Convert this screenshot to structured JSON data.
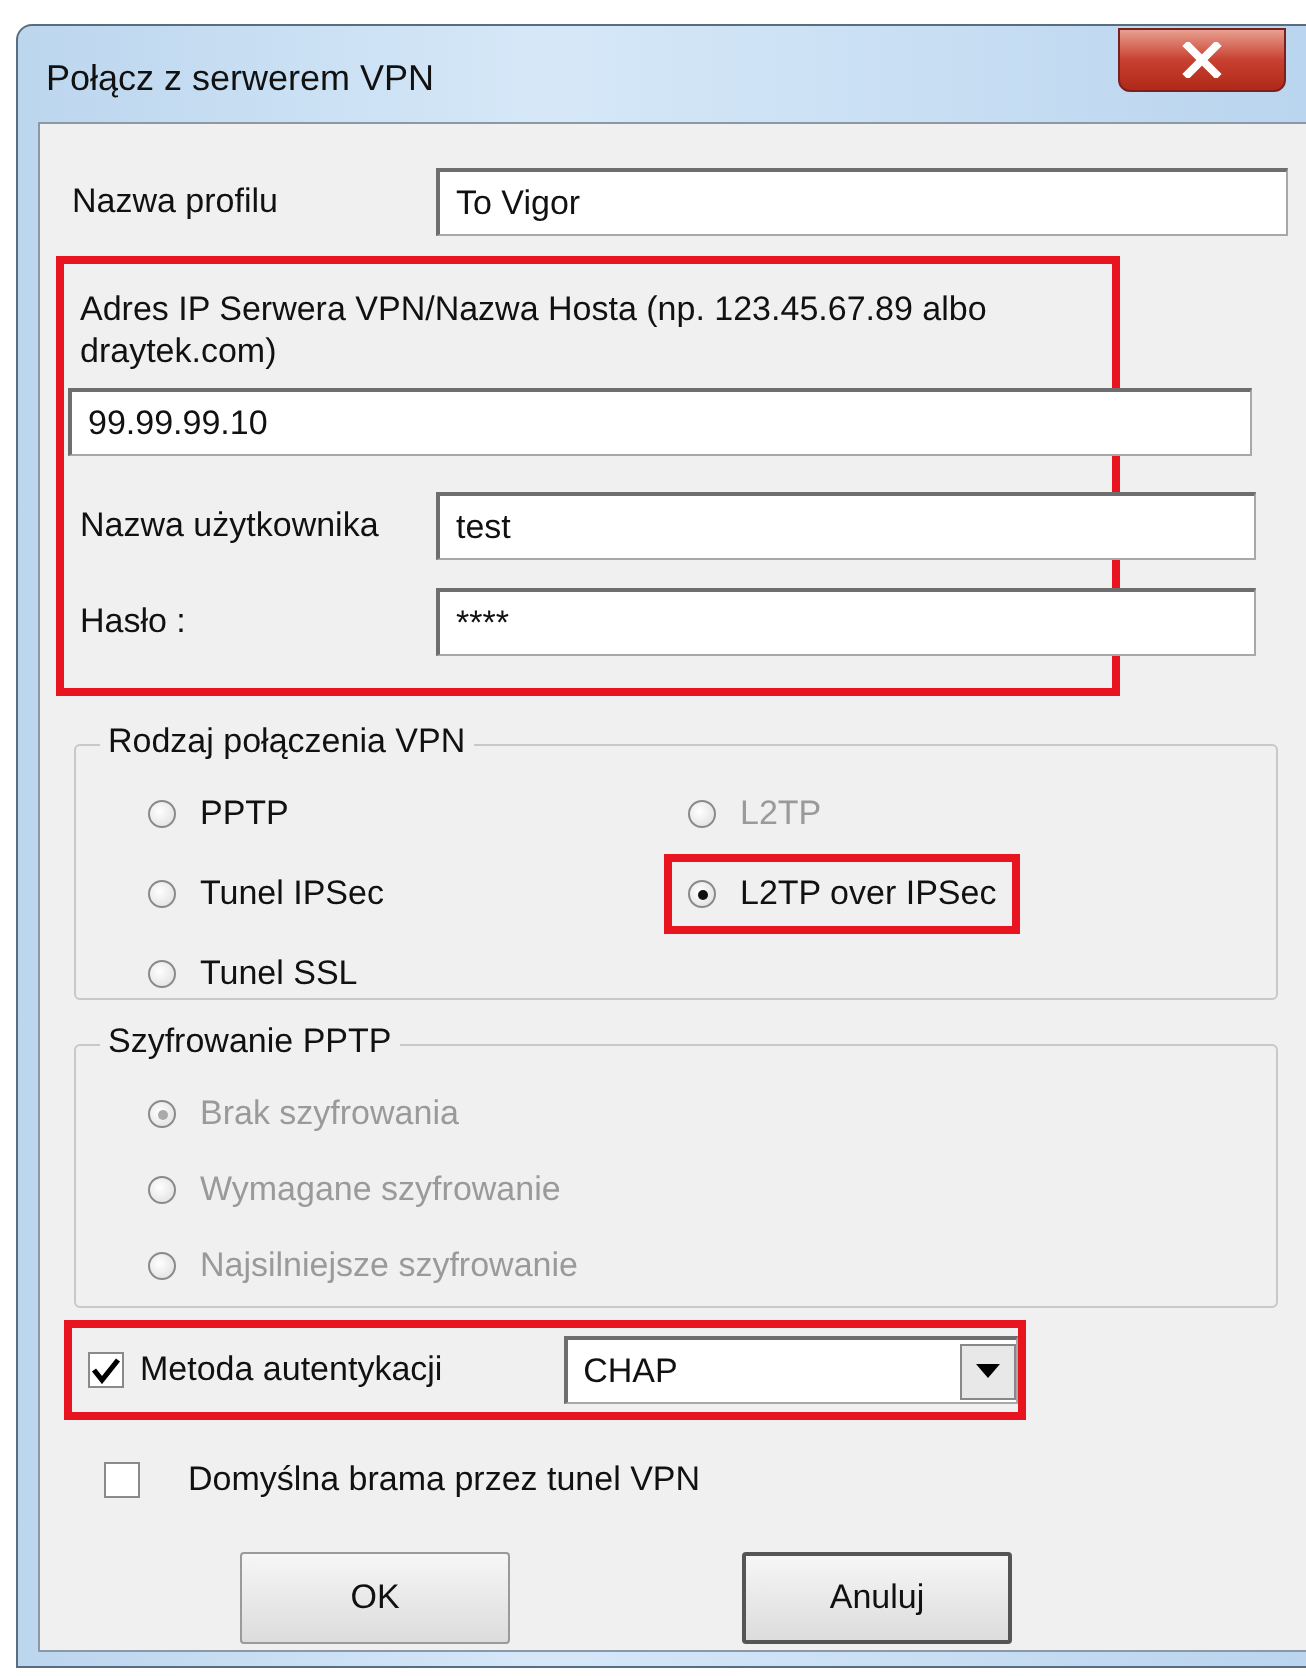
{
  "window": {
    "title": "Połącz z serwerem VPN"
  },
  "profile": {
    "label": "Nazwa profilu",
    "value": "To Vigor"
  },
  "login": {
    "highlighted": true,
    "fields": [
      {
        "kind": "stacked",
        "label": "Adres IP Serwera VPN/Nazwa Hosta (np. 123.45.67.89 albo draytek.com)",
        "value": "99.99.99.10"
      },
      {
        "kind": "inline",
        "label": "Nazwa użytkownika",
        "value": "test"
      },
      {
        "kind": "inline",
        "label": "Hasło :",
        "value": "****"
      }
    ]
  },
  "connection_type": {
    "title": "Rodzaj połączenia VPN",
    "options": [
      {
        "label": "PPTP",
        "selected": false,
        "disabled": false,
        "highlighted": false
      },
      {
        "label": "L2TP",
        "selected": false,
        "disabled": true,
        "highlighted": false
      },
      {
        "label": "Tunel IPSec",
        "selected": false,
        "disabled": false,
        "highlighted": false
      },
      {
        "label": "L2TP over IPSec",
        "selected": true,
        "disabled": false,
        "highlighted": true
      },
      {
        "label": "Tunel SSL",
        "selected": false,
        "disabled": false,
        "highlighted": false
      }
    ]
  },
  "encryption": {
    "title": "Szyfrowanie PPTP",
    "options": [
      {
        "label": "Brak szyfrowania",
        "selected": true,
        "disabled": true
      },
      {
        "label": "Wymagane szyfrowanie",
        "selected": false,
        "disabled": true
      },
      {
        "label": "Najsilniejsze szyfrowanie",
        "selected": false,
        "disabled": true
      }
    ]
  },
  "auth": {
    "checked": true,
    "label": "Metoda autentykacji",
    "value": "CHAP",
    "highlighted": true
  },
  "default_gateway": {
    "checked": false,
    "label": "Domyślna brama przez tunel VPN"
  },
  "buttons": [
    "OK",
    "Anuluj"
  ]
}
